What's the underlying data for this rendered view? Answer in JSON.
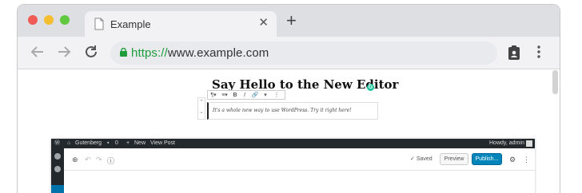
{
  "browser": {
    "traffic_lights": {
      "close": "#ee5c55",
      "minimize": "#f5be2f",
      "maximize": "#60c93f"
    },
    "tab": {
      "title": "Example",
      "close_glyph": "✕"
    },
    "new_tab_glyph": "+",
    "url_scheme": "https://",
    "url_rest": "www.example.com",
    "url_scheme_color": "#1e9c3b"
  },
  "editor_page": {
    "post_title": "Say Hello to the New Editor",
    "paragraph": "It's a whole new way to use WordPress. Try it right here!",
    "block_toolbar": [
      "¶▾",
      "≡▾",
      "B",
      "I",
      "🔗",
      "▾",
      "⋮"
    ],
    "mover": [
      "⌃",
      "⌄"
    ]
  },
  "wp_admin": {
    "adminbar": {
      "site": "Gutenberg",
      "comments": "0",
      "new": "New",
      "view": "View Post",
      "howdy": "Howdy, admin"
    },
    "header": {
      "saved": "Saved",
      "preview": "Preview",
      "publish": "Publish..."
    },
    "accent": "#0085ba"
  }
}
